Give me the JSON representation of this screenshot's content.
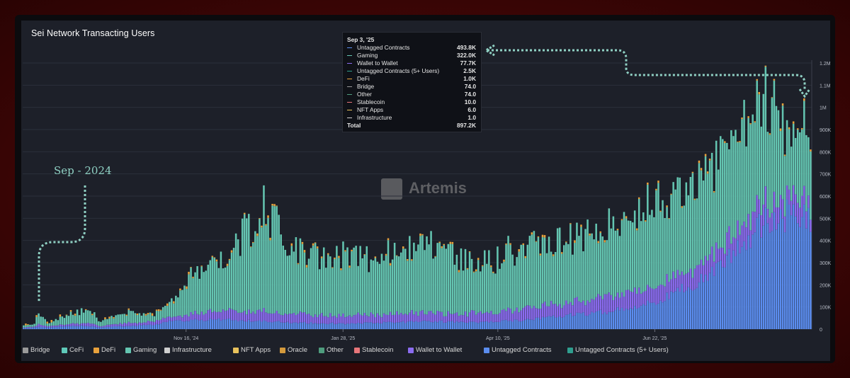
{
  "page": {
    "title": "Sei Network Transacting Users",
    "watermark": "Artemis"
  },
  "annotation": {
    "text": "Sep - 2024"
  },
  "tooltip": {
    "date": "Sep 3, '25",
    "rows": [
      {
        "name": "Untagged Contracts",
        "value": "493.8K",
        "color": "#5b8def"
      },
      {
        "name": "Gaming",
        "value": "322.0K",
        "color": "#64c5b1"
      },
      {
        "name": "Wallet to Wallet",
        "value": "77.7K",
        "color": "#8b6cf0"
      },
      {
        "name": "Untagged Contracts (5+ Users)",
        "value": "2.5K",
        "color": "#2f9e8f"
      },
      {
        "name": "DeFi",
        "value": "1.0K",
        "color": "#e8a13c"
      },
      {
        "name": "Bridge",
        "value": "74.0",
        "color": "#9a9a9a"
      },
      {
        "name": "Other",
        "value": "74.0",
        "color": "#4f9d7e"
      },
      {
        "name": "Stablecoin",
        "value": "10.0",
        "color": "#e8767a"
      },
      {
        "name": "NFT Apps",
        "value": "6.0",
        "color": "#e8c25c"
      },
      {
        "name": "Infrastructure",
        "value": "1.0",
        "color": "#cfcfcf"
      }
    ],
    "total_label": "Total",
    "total_value": "897.2K"
  },
  "legend": [
    {
      "name": "Bridge",
      "color": "#9a9a9a"
    },
    {
      "name": "CeFi",
      "color": "#5fc9b9"
    },
    {
      "name": "DeFi",
      "color": "#e8a13c"
    },
    {
      "name": "Gaming",
      "color": "#64c5b1"
    },
    {
      "name": "Infrastructure",
      "color": "#cfcfcf"
    },
    {
      "name": "NFT Apps",
      "color": "#e8c25c"
    },
    {
      "name": "Oracle",
      "color": "#d49a3c"
    },
    {
      "name": "Other",
      "color": "#4f9d7e"
    },
    {
      "name": "Stablecoin",
      "color": "#e8767a"
    },
    {
      "name": "Wallet to Wallet",
      "color": "#8b6cf0"
    },
    {
      "name": "Untagged Contracts",
      "color": "#5b8def"
    },
    {
      "name": "Untagged Contracts (5+ Users)",
      "color": "#2f9e8f"
    }
  ],
  "chart_data": {
    "type": "bar",
    "stacked": true,
    "title": "Sei Network Transacting Users",
    "y_axis_side": "right",
    "ylim": [
      0,
      1200000
    ],
    "y_ticks": [
      {
        "value": 0,
        "label": "0"
      },
      {
        "value": 100000,
        "label": "100K"
      },
      {
        "value": 200000,
        "label": "200K"
      },
      {
        "value": 300000,
        "label": "300K"
      },
      {
        "value": 400000,
        "label": "400K"
      },
      {
        "value": 500000,
        "label": "500K"
      },
      {
        "value": 600000,
        "label": "600K"
      },
      {
        "value": 700000,
        "label": "700K"
      },
      {
        "value": 800000,
        "label": "800K"
      },
      {
        "value": 900000,
        "label": "900K"
      },
      {
        "value": 1000000,
        "label": "1M"
      },
      {
        "value": 1100000,
        "label": "1.1M"
      },
      {
        "value": 1200000,
        "label": "1.2M"
      }
    ],
    "x_ticks": [
      {
        "date": "2024-11-16",
        "label": "Nov 16, '24"
      },
      {
        "date": "2025-01-28",
        "label": "Jan 28, '25"
      },
      {
        "date": "2025-04-10",
        "label": "Apr 10, '25"
      },
      {
        "date": "2025-06-22",
        "label": "Jun 22, '25"
      }
    ],
    "grid": true,
    "legend_position": "bottom",
    "x_range": [
      "2024-09-01",
      "2025-09-03"
    ],
    "anchors": [
      [
        "2024-09-01",
        5000,
        10000,
        3000
      ],
      [
        "2024-09-06",
        8000,
        10000,
        4000
      ],
      [
        "2024-09-08",
        12000,
        55000,
        10000
      ],
      [
        "2024-09-12",
        8000,
        15000,
        5000
      ],
      [
        "2024-09-25",
        15000,
        50000,
        10000
      ],
      [
        "2024-10-01",
        15000,
        70000,
        15000
      ],
      [
        "2024-10-07",
        8000,
        20000,
        5000
      ],
      [
        "2024-10-20",
        15000,
        50000,
        15000
      ],
      [
        "2024-11-01",
        20000,
        30000,
        15000
      ],
      [
        "2024-11-10",
        40000,
        80000,
        20000
      ],
      [
        "2024-11-20",
        40000,
        200000,
        35000
      ],
      [
        "2024-12-01",
        45000,
        240000,
        40000
      ],
      [
        "2024-12-10",
        40000,
        320000,
        40000
      ],
      [
        "2024-12-22",
        35000,
        500000,
        45000
      ],
      [
        "2025-01-05",
        30000,
        300000,
        40000
      ],
      [
        "2025-01-28",
        25000,
        270000,
        35000
      ],
      [
        "2025-02-20",
        30000,
        280000,
        40000
      ],
      [
        "2025-03-10",
        35000,
        300000,
        40000
      ],
      [
        "2025-04-01",
        30000,
        230000,
        40000
      ],
      [
        "2025-04-20",
        40000,
        280000,
        50000
      ],
      [
        "2025-05-10",
        60000,
        300000,
        60000
      ],
      [
        "2025-06-01",
        80000,
        320000,
        70000
      ],
      [
        "2025-06-22",
        120000,
        380000,
        70000
      ],
      [
        "2025-07-10",
        200000,
        400000,
        80000
      ],
      [
        "2025-07-25",
        300000,
        450000,
        80000
      ],
      [
        "2025-08-05",
        420000,
        480000,
        85000
      ],
      [
        "2025-08-15",
        500000,
        450000,
        80000
      ],
      [
        "2025-08-25",
        520000,
        320000,
        80000
      ],
      [
        "2025-09-03",
        493800,
        322000,
        77700
      ]
    ],
    "anchor_fields": [
      "date",
      "Untagged Contracts",
      "Gaming",
      "Wallet to Wallet"
    ]
  }
}
